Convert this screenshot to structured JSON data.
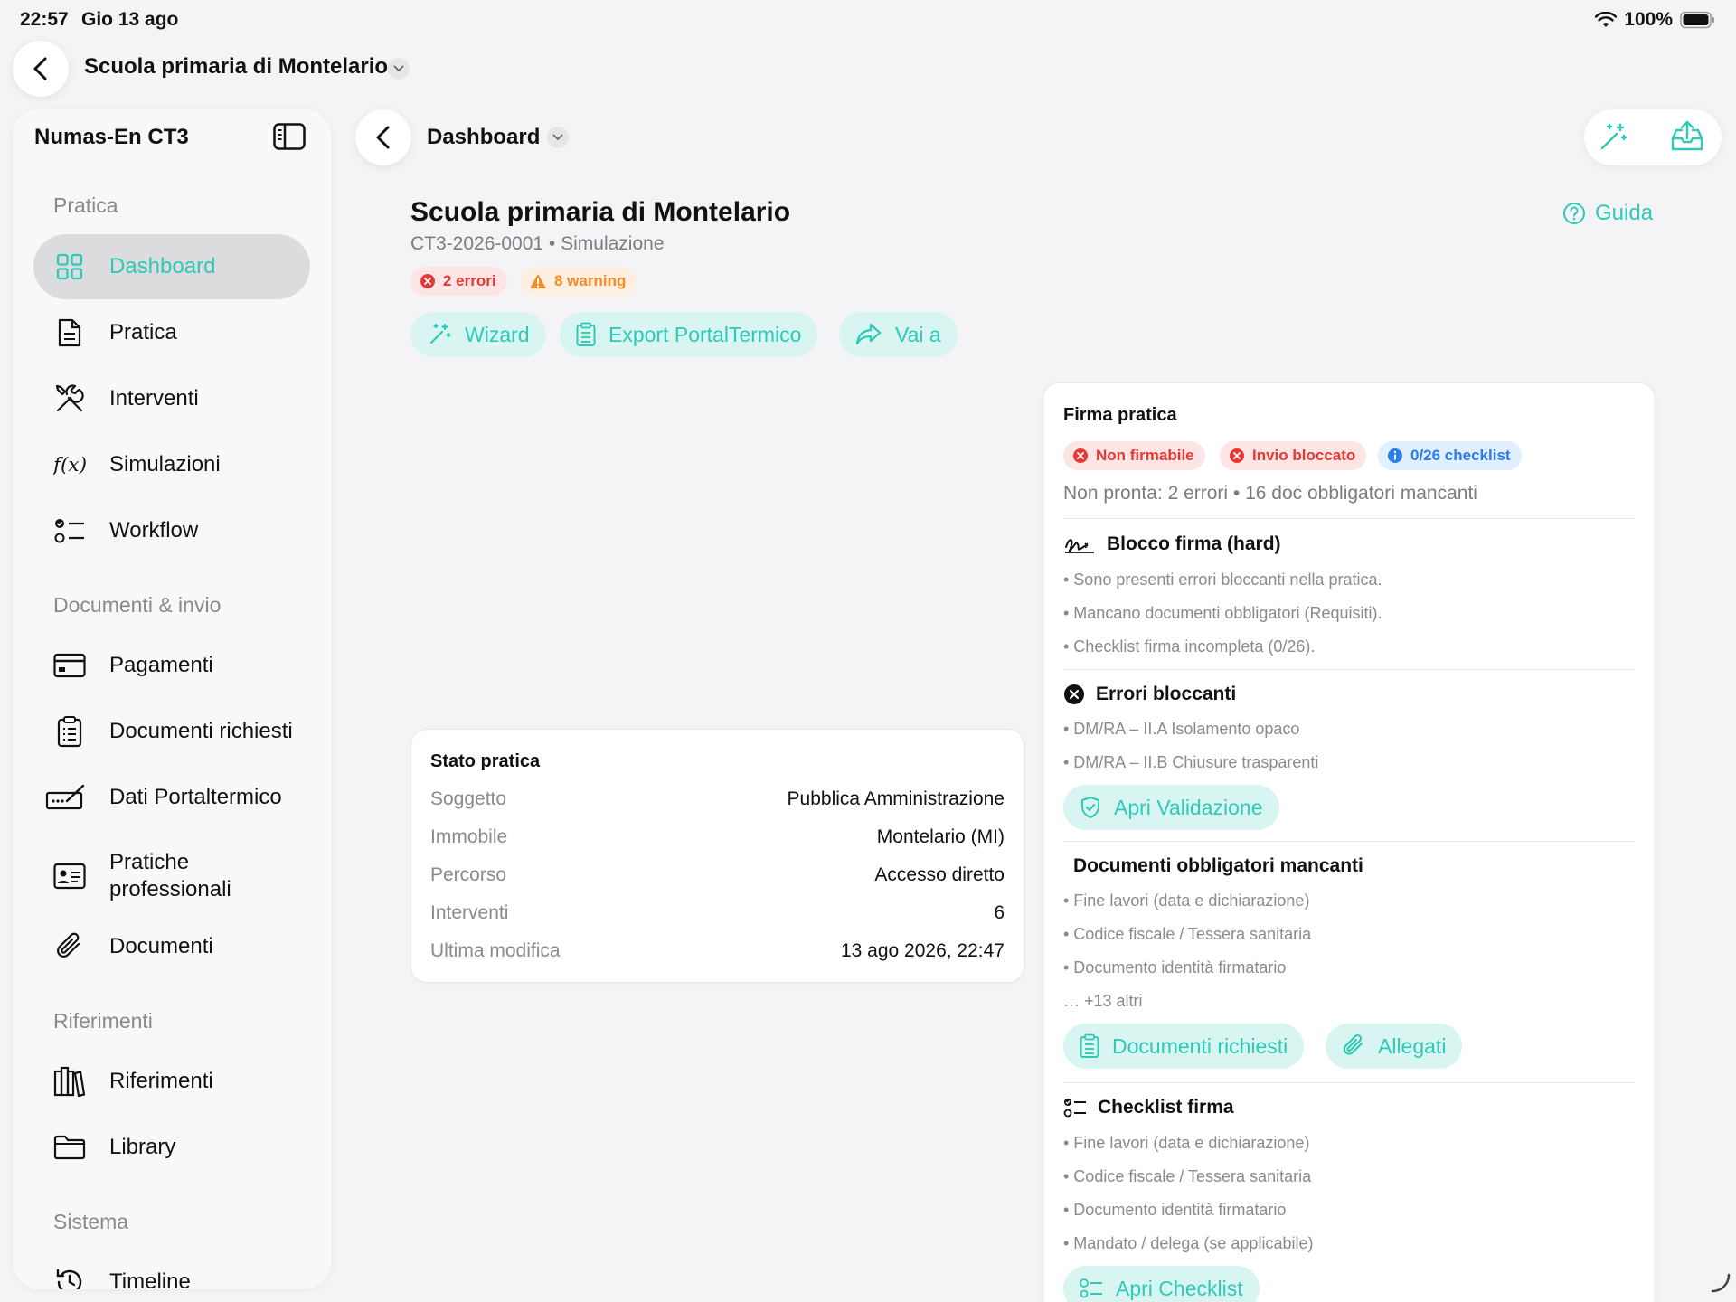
{
  "status_bar": {
    "time": "22:57",
    "date": "Gio 13 ago",
    "battery": "100%"
  },
  "top_bar": {
    "title": "Scuola primaria di Montelario"
  },
  "sidebar": {
    "title": "Numas-En CT3",
    "sections": [
      {
        "label": "Pratica"
      },
      {
        "label": "Documenti & invio"
      },
      {
        "label": "Riferimenti"
      },
      {
        "label": "Sistema"
      }
    ],
    "items": [
      {
        "label": "Dashboard",
        "icon": "grid-icon",
        "active": true
      },
      {
        "label": "Pratica",
        "icon": "document-icon"
      },
      {
        "label": "Interventi",
        "icon": "tools-icon"
      },
      {
        "label": "Simulazioni",
        "icon": "function-icon"
      },
      {
        "label": "Workflow",
        "icon": "checklist-icon"
      },
      {
        "label": "Pagamenti",
        "icon": "card-icon"
      },
      {
        "label": "Documenti richiesti",
        "icon": "clipboard-icon"
      },
      {
        "label": "Dati Portaltermico",
        "icon": "signature-icon"
      },
      {
        "label": "Pratiche\nprofessionali",
        "label_line1": "Pratiche",
        "label_line2": "professionali",
        "icon": "id-card-icon"
      },
      {
        "label": "Documenti",
        "icon": "paperclip-icon"
      },
      {
        "label": "Riferimenti",
        "icon": "books-icon"
      },
      {
        "label": "Library",
        "icon": "folder-icon"
      },
      {
        "label": "Timeline",
        "icon": "history-icon"
      }
    ]
  },
  "main": {
    "breadcrumb": "Dashboard",
    "title": "Scuola primaria di Montelario",
    "subtitle": "CT3-2026-0001 • Simulazione",
    "guide_label": "Guida",
    "badges": {
      "errors": "2 errori",
      "warnings": "8 warning"
    },
    "actions": {
      "wizard": "Wizard",
      "export": "Export PortalTermico",
      "goto": "Vai a"
    }
  },
  "stato_pratica": {
    "title": "Stato pratica",
    "rows": [
      {
        "key": "Soggetto",
        "value": "Pubblica Amministrazione"
      },
      {
        "key": "Immobile",
        "value": "Montelario (MI)"
      },
      {
        "key": "Percorso",
        "value": "Accesso diretto"
      },
      {
        "key": "Interventi",
        "value": "6"
      },
      {
        "key": "Ultima modifica",
        "value": "13 ago 2026, 22:47"
      }
    ]
  },
  "firma": {
    "title": "Firma pratica",
    "badges": {
      "non_firmabile": "Non firmabile",
      "invio_bloccato": "Invio bloccato",
      "checklist": "0/26 checklist"
    },
    "summary": "Non pronta: 2 errori • 16 doc obbligatori mancanti",
    "blocco": {
      "title": "Blocco firma (hard)",
      "items": [
        "• Sono presenti errori bloccanti nella pratica.",
        "• Mancano documenti obbligatori (Requisiti).",
        "• Checklist firma incompleta (0/26)."
      ]
    },
    "errori": {
      "title": "Errori bloccanti",
      "items": [
        "• DM/RA – II.A Isolamento opaco",
        "• DM/RA – II.B Chiusure trasparenti"
      ],
      "button": "Apri Validazione"
    },
    "documenti": {
      "title": "Documenti obbligatori mancanti",
      "items": [
        "• Fine lavori (data e dichiarazione)",
        "• Codice fiscale / Tessera sanitaria",
        "• Documento identità firmatario"
      ],
      "more": "… +13 altri",
      "button_docs": "Documenti richiesti",
      "button_attach": "Allegati"
    },
    "checklist": {
      "title": "Checklist firma",
      "items": [
        "• Fine lavori (data e dichiarazione)",
        "• Codice fiscale / Tessera sanitaria",
        "• Documento identità firmatario",
        "• Mandato / delega (se applicabile)"
      ],
      "button": "Apri Checklist"
    }
  },
  "colors": {
    "accent": "#2ec9b7",
    "accent_bg": "#d9f5f1",
    "error": "#e53935",
    "warning": "#f08c2c",
    "info": "#2b7de9"
  }
}
